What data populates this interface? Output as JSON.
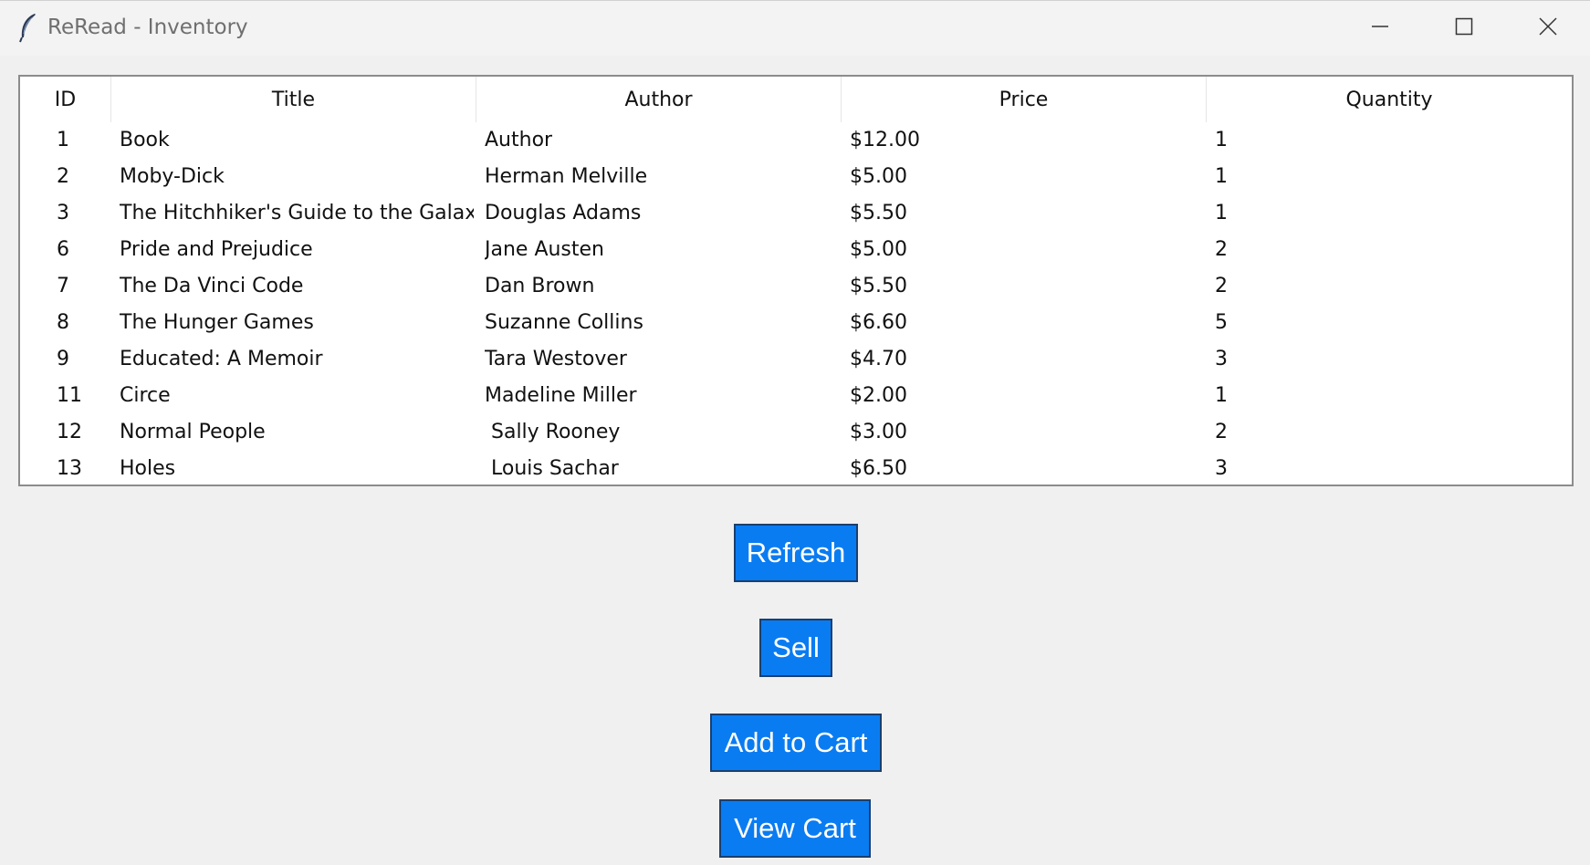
{
  "window": {
    "title": "ReRead - Inventory"
  },
  "icons": {
    "app": "feather-icon",
    "minimize": "minimize-icon",
    "maximize": "maximize-icon",
    "close": "close-icon"
  },
  "table": {
    "columns": [
      "ID",
      "Title",
      "Author",
      "Price",
      "Quantity"
    ],
    "rows": [
      {
        "id": "1",
        "title": "Book",
        "author": "Author",
        "price": "$12.00",
        "quantity": "1"
      },
      {
        "id": "2",
        "title": "Moby-Dick",
        "author": "Herman Melville",
        "price": "$5.00",
        "quantity": "1"
      },
      {
        "id": "3",
        "title": "The Hitchhiker's Guide to the Galaxy",
        "author": "Douglas Adams",
        "price": "$5.50",
        "quantity": "1"
      },
      {
        "id": "6",
        "title": "Pride and Prejudice",
        "author": "Jane Austen",
        "price": "$5.00",
        "quantity": "2"
      },
      {
        "id": "7",
        "title": "The Da Vinci Code",
        "author": "Dan Brown",
        "price": "$5.50",
        "quantity": "2"
      },
      {
        "id": "8",
        "title": "The Hunger Games",
        "author": "Suzanne Collins",
        "price": "$6.60",
        "quantity": "5"
      },
      {
        "id": "9",
        "title": "Educated: A Memoir",
        "author": "Tara Westover",
        "price": "$4.70",
        "quantity": "3"
      },
      {
        "id": "11",
        "title": "Circe",
        "author": "Madeline Miller",
        "price": "$2.00",
        "quantity": "1"
      },
      {
        "id": "12",
        "title": "Normal People",
        "author": " Sally Rooney",
        "price": "$3.00",
        "quantity": "2"
      },
      {
        "id": "13",
        "title": "Holes",
        "author": " Louis Sachar",
        "price": "$6.50",
        "quantity": "3"
      }
    ]
  },
  "buttons": {
    "refresh": "Refresh",
    "sell": "Sell",
    "add_to_cart": "Add to Cart",
    "view_cart": "View Cart"
  },
  "colors": {
    "button_bg": "#0a7cf2",
    "button_text": "#ffffff",
    "window_bg": "#f0f0f0"
  }
}
